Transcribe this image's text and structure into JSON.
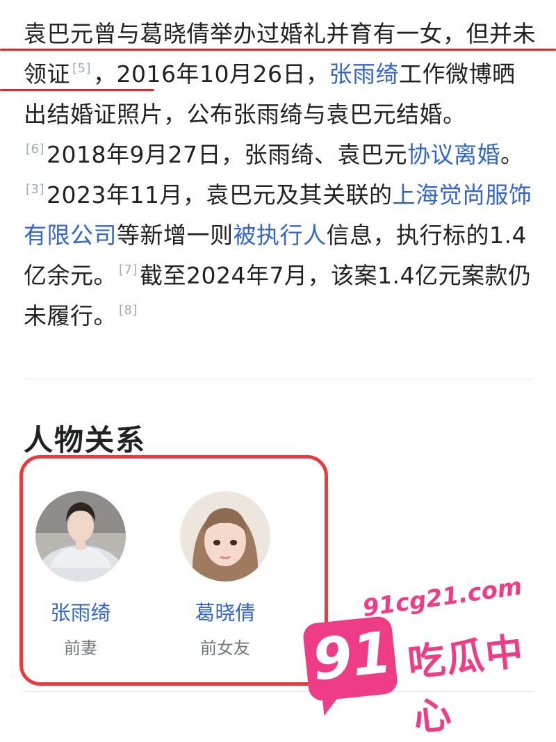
{
  "article": {
    "p1": "袁巴元曾与葛晓倩举办过婚礼并育有一女，但",
    "p2a": "并未领证",
    "ref5": "[5]",
    "p2b": "，2016年10月26日，",
    "link_zhang": "张雨绮",
    "p2c": "工作微博晒出结婚证照片，公布张雨绮与袁巴元结婚。",
    "ref6": "[6]",
    "p3a": "2018年9月27日，张雨绮、袁巴元",
    "link_xieyi": "协议离婚",
    "p3b": "。",
    "ref3": "[3]",
    "p4a": "2023年11月，袁巴元及其关联的",
    "link_company": "上海觉尚服饰有限公司",
    "p4b": "等新增一则",
    "link_beizhixing": "被执行人",
    "p4c": "信息，执行标的1.4亿余元。",
    "ref7": "[7]",
    "p5": "截至2024年7月，该案1.4亿元案款仍未履行。",
    "ref8": "[8]"
  },
  "relations": {
    "title": "人物关系",
    "people": [
      {
        "name": "张雨绮",
        "role": "前妻"
      },
      {
        "name": "葛晓倩",
        "role": "前女友"
      }
    ]
  },
  "watermark": {
    "url": "91cg21.com",
    "badge": "91",
    "text": "吃瓜中心"
  },
  "colors": {
    "link": "#3366cc",
    "annotation_red": "#e3262a",
    "watermark_pink": "#ef3c86"
  }
}
